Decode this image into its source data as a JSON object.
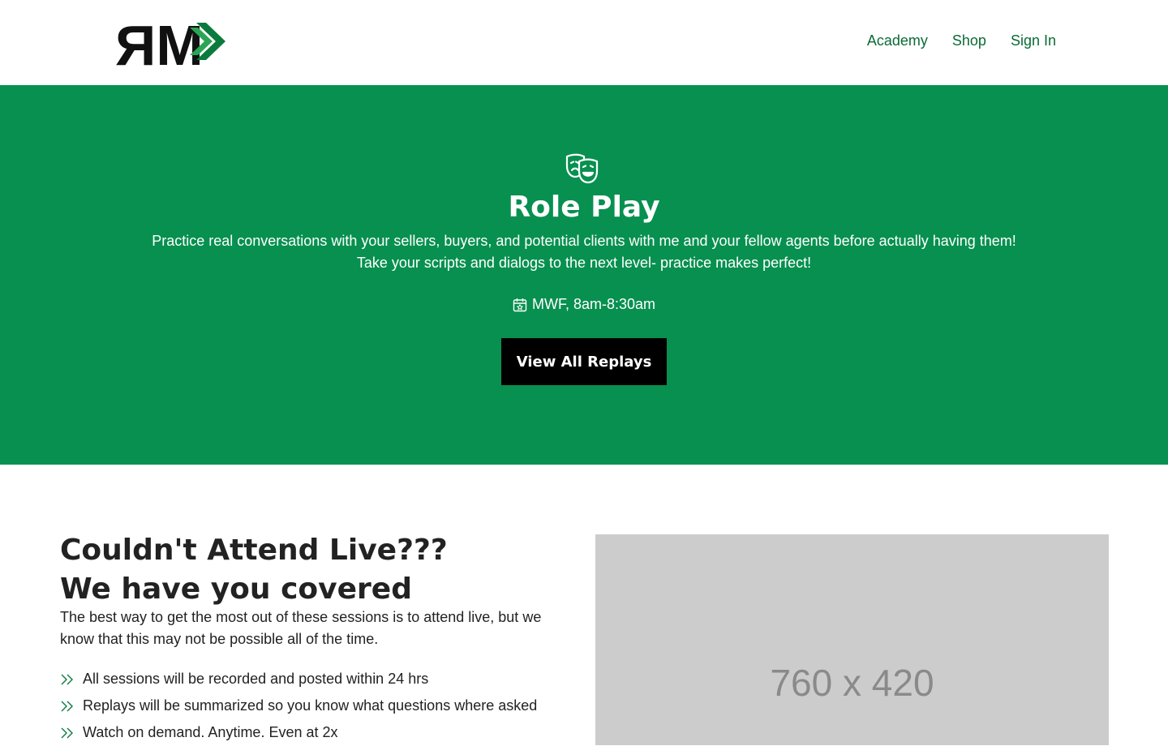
{
  "header": {
    "logo_text": "RM",
    "nav": [
      "Academy",
      "Shop",
      "Sign In"
    ]
  },
  "hero": {
    "icon": "theater-masks-icon",
    "title": "Role Play",
    "description_line1": "Practice real conversations with your sellers, buyers, and potential clients with me and your fellow agents before actually having them!",
    "description_line2": "Take your scripts and dialogs to the next level- practice makes perfect!",
    "schedule_icon": "calendar-star-icon",
    "schedule": "MWF, 8am-8:30am",
    "cta_label": "View All Replays",
    "background": "#07904f"
  },
  "section": {
    "title_line1": "Couldn't Attend Live???",
    "title_line2": "We have you covered",
    "description": "The best way to get the most out of these sessions is to attend live, but we know that this may not be possible all of the time.",
    "list_icon": "double-chevron-right-icon",
    "items": [
      "All sessions will be recorded and posted within 24 hrs",
      "Replays will be summarized so you know what questions where asked",
      "Watch on demand. Anytime. Even at 2x"
    ],
    "image_placeholder": "760 x 420"
  },
  "colors": {
    "brand_green": "#07904f",
    "nav_green": "#0a6b35",
    "button": "#000000"
  }
}
